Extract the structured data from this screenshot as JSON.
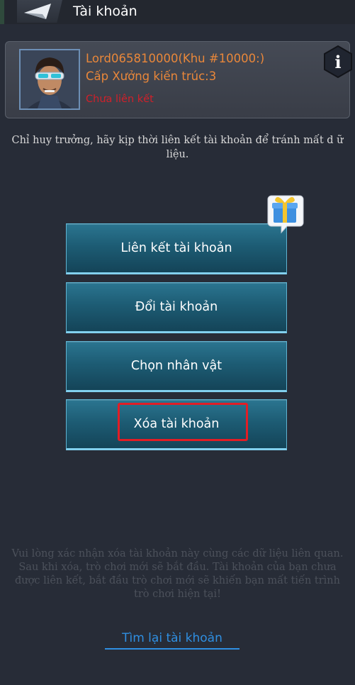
{
  "header": {
    "title": "Tài khoản"
  },
  "profile": {
    "name": "Lord065810000(Khu #10000:)",
    "level": "Cấp Xưởng kiến trúc:3",
    "link_status": "Chưa liên kết",
    "info_label": "i"
  },
  "hint": "Chỉ huy trưởng, hãy kịp thời liên kết tài khoản để tránh mất d ữ liệu.",
  "buttons": {
    "link": "Liên kết tài khoản",
    "switch": "Đổi tài khoản",
    "choose": "Chọn nhân vật",
    "delete": "Xóa tài khoản"
  },
  "warning": "Vui lòng xác nhận xóa tài khoản này cùng các dữ liệu liên quan. Sau khi xóa, trò chơi mới sẽ bắt đầu. Tài khoản của bạn chưa được liên kết, bắt đầu trò chơi mới sẽ khiến bạn mất tiến trình trò chơi hiện tại!",
  "recover_link": "Tìm lại tài khoản",
  "colors": {
    "background": "#272c37",
    "accent_orange": "#e9873a",
    "status_red": "#d0202a",
    "button_teal": "#1d5c74",
    "link_blue": "#2f8fe2",
    "highlight_red": "#e21d25"
  },
  "icons": {
    "back": "paper-plane-back-icon",
    "info": "info-hexagon-icon",
    "gift": "gift-box-icon"
  }
}
